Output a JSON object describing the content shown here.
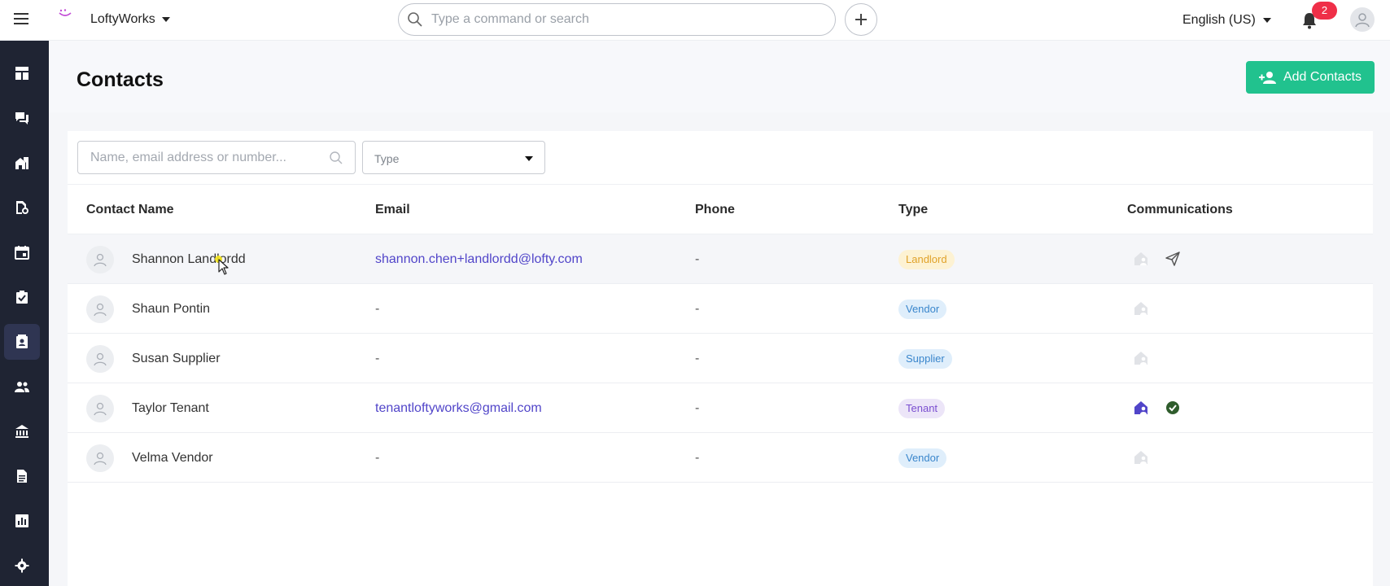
{
  "topbar": {
    "workspace": "LoftyWorks",
    "search_placeholder": "Type a command or search",
    "language": "English (US)",
    "notification_count": "2"
  },
  "sidebar": {
    "items": [
      {
        "icon": "dashboard-icon"
      },
      {
        "icon": "messages-icon"
      },
      {
        "icon": "properties-icon"
      },
      {
        "icon": "maintenance-icon"
      },
      {
        "icon": "calendar-icon"
      },
      {
        "icon": "tasks-icon"
      },
      {
        "icon": "contacts-icon",
        "active": true
      },
      {
        "icon": "people-icon"
      },
      {
        "icon": "bank-icon"
      },
      {
        "icon": "document-icon"
      },
      {
        "icon": "reports-icon"
      },
      {
        "icon": "settings-icon"
      }
    ]
  },
  "header": {
    "title": "Contacts",
    "add_button": "Add Contacts"
  },
  "filters": {
    "search_placeholder": "Name, email address or number...",
    "type_label": "Type"
  },
  "table": {
    "columns": [
      "Contact Name",
      "Email",
      "Phone",
      "Type",
      "Communications"
    ],
    "rows": [
      {
        "name": "Shannon Landlordd",
        "email": "shannon.chen+landlordd@lofty.com",
        "phone": "-",
        "type": "Landlord",
        "portal_active": false,
        "extra": "send-icon"
      },
      {
        "name": "Shaun Pontin",
        "email": "-",
        "phone": "-",
        "type": "Vendor",
        "portal_active": false,
        "extra": ""
      },
      {
        "name": "Susan Supplier",
        "email": "-",
        "phone": "-",
        "type": "Supplier",
        "portal_active": false,
        "extra": ""
      },
      {
        "name": "Taylor Tenant",
        "email": "tenantloftyworks@gmail.com",
        "phone": "-",
        "type": "Tenant",
        "portal_active": true,
        "extra": "check-circle-icon"
      },
      {
        "name": "Velma Vendor",
        "email": "-",
        "phone": "-",
        "type": "Vendor",
        "portal_active": false,
        "extra": ""
      }
    ]
  },
  "colors": {
    "accent": "#21c28e",
    "sidebar": "#1f2433",
    "link": "#5145c9",
    "badge": "#ef2f48"
  }
}
